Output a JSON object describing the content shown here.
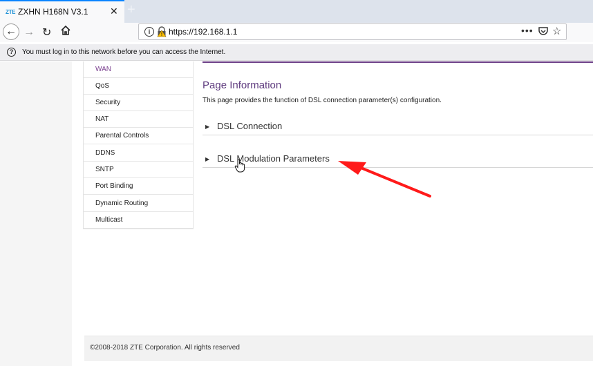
{
  "browser": {
    "tab": {
      "logo": "ZTE",
      "title": "ZXHN H168N V3.1",
      "close": "✕"
    },
    "url": "https://192.168.1.1",
    "notification": "You must log in to this network before you can access the Internet."
  },
  "menu": {
    "items": [
      {
        "label": "WAN",
        "active": true
      },
      {
        "label": "QoS"
      },
      {
        "label": "Security"
      },
      {
        "label": "NAT"
      },
      {
        "label": "Parental Controls"
      },
      {
        "label": "DDNS"
      },
      {
        "label": "SNTP"
      },
      {
        "label": "Port Binding"
      },
      {
        "label": "Dynamic Routing"
      },
      {
        "label": "Multicast"
      }
    ]
  },
  "main": {
    "heading": "Page Information",
    "description": "This page provides the function of DSL connection parameter(s) configuration.",
    "sections": [
      {
        "title": "DSL Connection"
      },
      {
        "title": "DSL Modulation Parameters"
      }
    ]
  },
  "footer": {
    "text": "©2008-2018 ZTE Corporation. All rights reserved"
  },
  "colors": {
    "accent": "#6b3d86",
    "annotation": "#ff1a1a",
    "tab_highlight": "#0a84ff"
  }
}
